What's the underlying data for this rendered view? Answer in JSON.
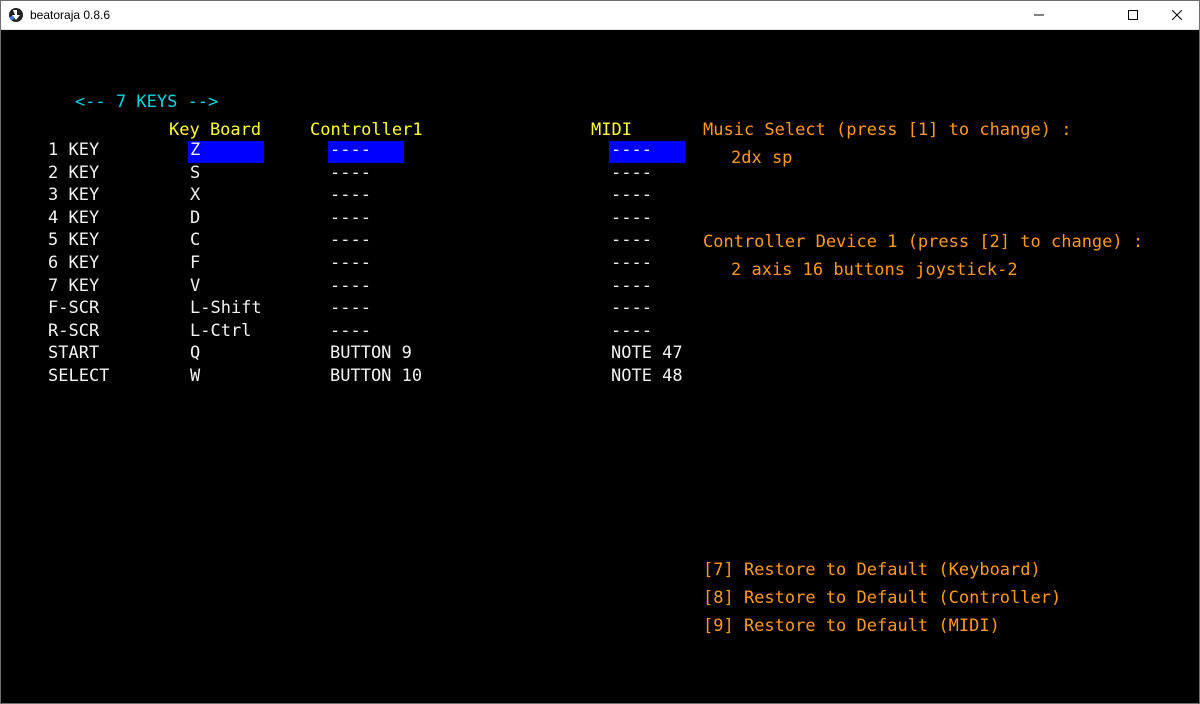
{
  "window": {
    "title": "beatoraja 0.8.6",
    "icon": "beatoraja-icon",
    "controls": [
      "minimize-icon",
      "maximize-icon",
      "close-icon"
    ]
  },
  "mode_label": "<-- 7 KEYS -->",
  "headers": {
    "keyboard": "Key Board",
    "controller": "Controller1",
    "midi": "MIDI"
  },
  "rows": [
    {
      "name": "1 KEY",
      "keyboard": "Z",
      "controller": "----",
      "midi": "----"
    },
    {
      "name": "2 KEY",
      "keyboard": "S",
      "controller": "----",
      "midi": "----"
    },
    {
      "name": "3 KEY",
      "keyboard": "X",
      "controller": "----",
      "midi": "----"
    },
    {
      "name": "4 KEY",
      "keyboard": "D",
      "controller": "----",
      "midi": "----"
    },
    {
      "name": "5 KEY",
      "keyboard": "C",
      "controller": "----",
      "midi": "----"
    },
    {
      "name": "6 KEY",
      "keyboard": "F",
      "controller": "----",
      "midi": "----"
    },
    {
      "name": "7 KEY",
      "keyboard": "V",
      "controller": "----",
      "midi": "----"
    },
    {
      "name": "F-SCR",
      "keyboard": "L-Shift",
      "controller": "----",
      "midi": "----"
    },
    {
      "name": "R-SCR",
      "keyboard": "L-Ctrl",
      "controller": "----",
      "midi": "----"
    },
    {
      "name": "START",
      "keyboard": "Q",
      "controller": "BUTTON 9",
      "midi": "NOTE 47"
    },
    {
      "name": "SELECT",
      "keyboard": "W",
      "controller": "BUTTON 10",
      "midi": "NOTE 48"
    }
  ],
  "selected_row": 1,
  "music_select": {
    "label": "Music Select (press [1] to change) :",
    "value": "2dx sp"
  },
  "controller_device": {
    "label": "Controller Device 1 (press [2] to change) :",
    "value": "2 axis 16 buttons joystick-2"
  },
  "restore": [
    "[7] Restore to Default (Keyboard)",
    "[8] Restore to Default (Controller)",
    "[9] Restore to Default (MIDI)"
  ],
  "colors": {
    "background": "#000000",
    "mode_label": "#00d7e0",
    "headers": "#ffff33",
    "rows": "#f2f2f2",
    "info": "#ff9a1f",
    "selection": "#0000ff"
  }
}
